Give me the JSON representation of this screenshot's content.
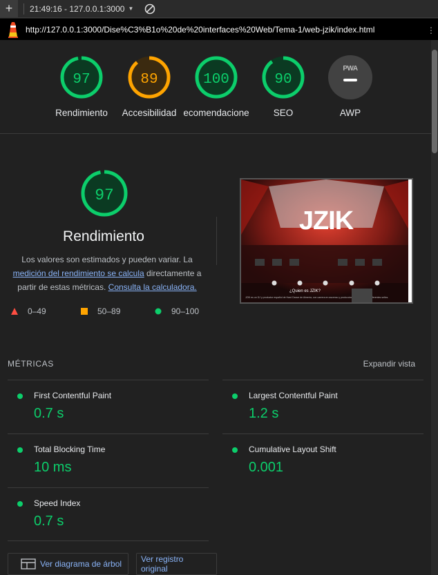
{
  "topbar": {
    "timestamp": "21:49:16 - 127.0.0.1:3000"
  },
  "urlbar": {
    "url": "http://127.0.0.1:3000/Dise%C3%B1o%20de%20interfaces%20Web/Tema-1/web-jzik/index.html"
  },
  "gauges": [
    {
      "score": "97",
      "label": "Rendimiento",
      "color": "#0cce6b",
      "bg": "#0b3a22",
      "ratio": 0.97
    },
    {
      "score": "89",
      "label": "Accesibilidad",
      "color": "#ffa400",
      "bg": "#3b2a10",
      "ratio": 0.89
    },
    {
      "score": "100",
      "label": "ecomendacione",
      "color": "#0cce6b",
      "bg": "#0b3a22",
      "ratio": 1.0
    },
    {
      "score": "90",
      "label": "SEO",
      "color": "#0cce6b",
      "bg": "#0b3a22",
      "ratio": 0.9
    },
    {
      "pwa_text": "PWA",
      "label": "AWP"
    }
  ],
  "category": {
    "score": "97",
    "ratio": 0.97,
    "title": "Rendimiento",
    "desc_1": "Los valores son estimados y pueden variar. La",
    "desc_link1": "medición del rendimiento se calcula",
    "desc_2": " directamente a partir de estas métricas.",
    "desc_link2": "Consulta la calculadora."
  },
  "legend": [
    {
      "range": "0–49",
      "color": "#ff4e42"
    },
    {
      "range": "50–89",
      "color": "#ffa400"
    },
    {
      "range": "90–100",
      "color": "#0cce6b"
    }
  ],
  "screenshot": {
    "logo": "JZIK",
    "heading": "¿Quien es JZIK?",
    "blurb": "JZIK es un DJ y productor español de Hard Dance de Almería, con carrera en ascenso y producciones firmadas con diferentes sellos."
  },
  "metrics": {
    "heading": "MÉTRICAS",
    "expand": "Expandir vista",
    "items": [
      {
        "name": "First Contentful Paint",
        "value": "0.7 s"
      },
      {
        "name": "Largest Contentful Paint",
        "value": "1.2 s"
      },
      {
        "name": "Total Blocking Time",
        "value": "10 ms"
      },
      {
        "name": "Cumulative Layout Shift",
        "value": "0.001"
      },
      {
        "name": "Speed Index",
        "value": "0.7 s"
      }
    ]
  },
  "buttons": {
    "treemap": "Ver diagrama de árbol",
    "original": "Ver registro original"
  },
  "colors": {
    "good": "#0cce6b",
    "average": "#ffa400",
    "fail": "#ff4e42",
    "link": "#8ab4f8"
  }
}
